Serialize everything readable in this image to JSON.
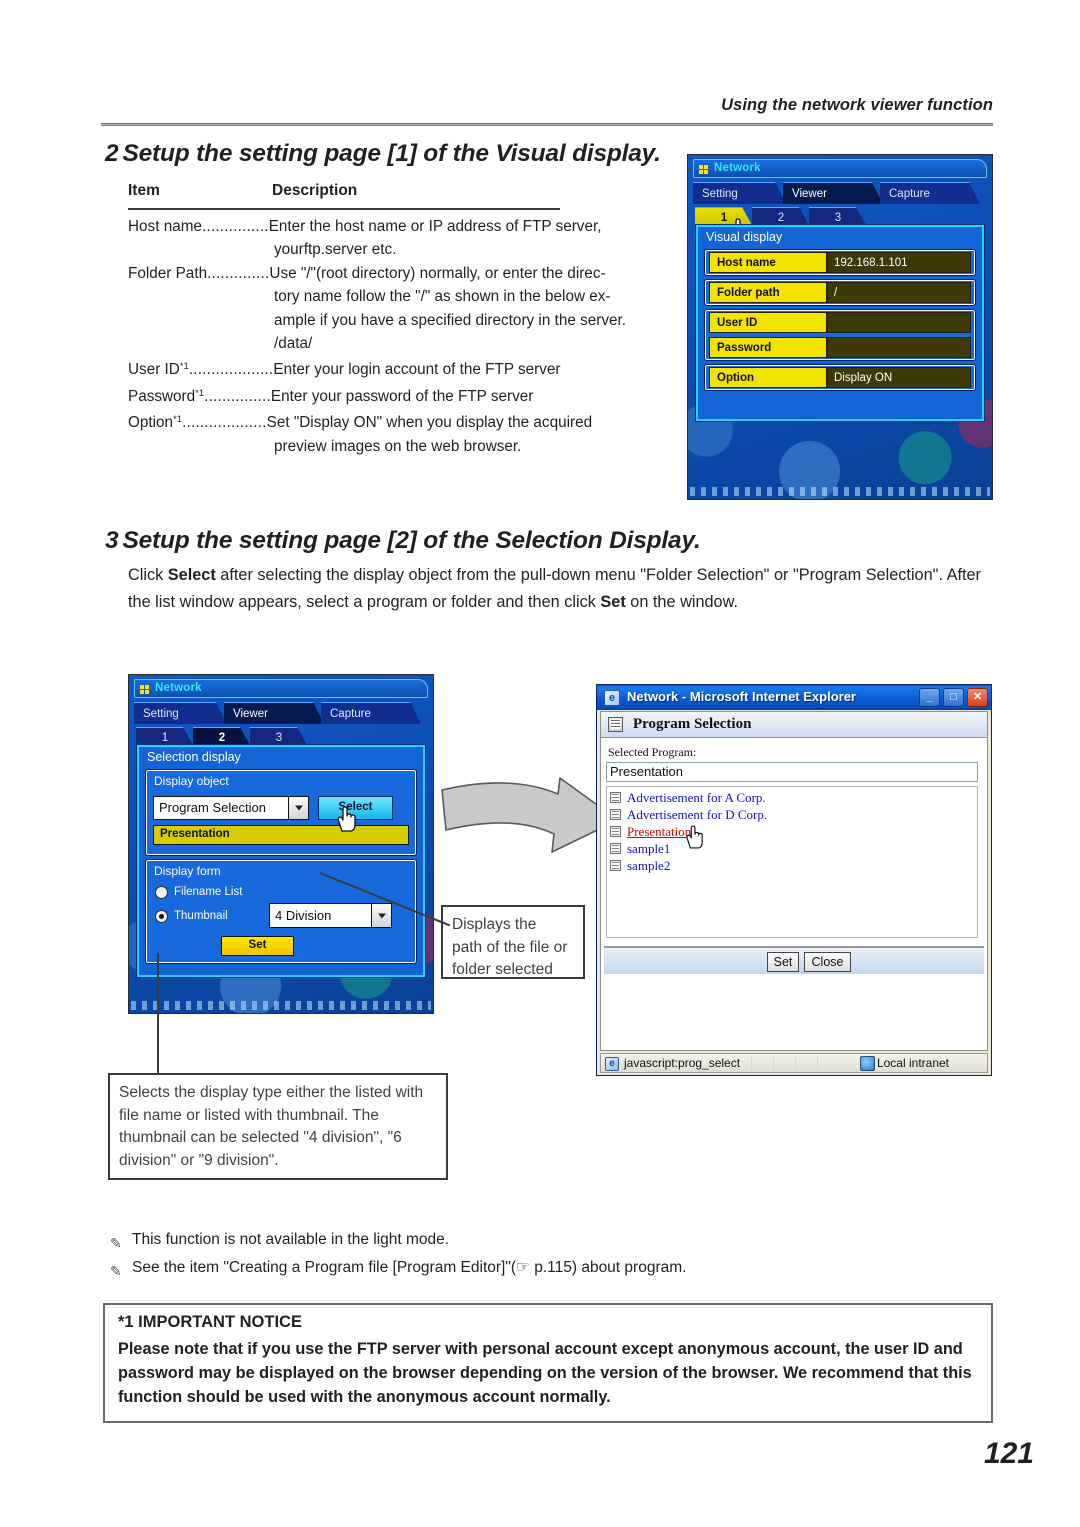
{
  "header": {
    "running_title": "Using the network viewer function"
  },
  "section2": {
    "number": "2",
    "title": "Setup the setting page [1] of the Visual display.",
    "table": {
      "col1": "Item",
      "col2": "Description",
      "rows": [
        {
          "label": "Host name",
          "dots": "...............",
          "desc": "Enter the host name or IP address of FTP server,",
          "cont": [
            "yourftp.server etc."
          ]
        },
        {
          "label": "Folder Path",
          "dots": "..............",
          "desc": "Use \"/\"(root directory) normally, or enter the direc-",
          "cont": [
            "tory name follow the \"/\" as shown in the below ex-",
            "ample if you have a specified directory in the server.",
            "/data/"
          ]
        },
        {
          "label": "User ID*1",
          "dots": "...................",
          "desc": "Enter your login account of the FTP server",
          "cont": []
        },
        {
          "label": "Password*1",
          "dots": "...............",
          "desc": "Enter your password of the FTP server",
          "cont": []
        },
        {
          "label": "Option*1",
          "dots": "...................",
          "desc": "Set \"Display ON\" when you display the acquired",
          "cont": [
            "preview images on the web browser."
          ]
        }
      ]
    }
  },
  "section3": {
    "number": "3",
    "title": "Setup the setting page [2] of the Selection Display.",
    "paragraph_parts": [
      {
        "t": "Click ",
        "b": false
      },
      {
        "t": "Select",
        "b": true
      },
      {
        "t": " after selecting the display object from the pull-down menu \"Folder Selection\" or \"Program Selection\". After the list window appears, select a program or folder and then click ",
        "b": false
      },
      {
        "t": "Set",
        "b": true
      },
      {
        "t": " on the window.",
        "b": false
      }
    ]
  },
  "osd1": {
    "title": "Network",
    "tabs": [
      {
        "label": "Setting",
        "active": false
      },
      {
        "label": "Viewer",
        "active": true
      },
      {
        "label": "Capture",
        "active": false
      }
    ],
    "subtabs": [
      {
        "label": "1",
        "state": "yellow"
      },
      {
        "label": "2",
        "state": "normal"
      },
      {
        "label": "3",
        "state": "normal"
      }
    ],
    "panel_title": "Visual display",
    "fields": [
      {
        "label": "Host name",
        "value": "192.168.1.101"
      },
      {
        "label": "Folder path",
        "value": "/"
      },
      {
        "label": "User ID",
        "value": ""
      },
      {
        "label": "Password",
        "value": ""
      },
      {
        "label": "Option",
        "value": "Display  ON"
      }
    ]
  },
  "osd2": {
    "title": "Network",
    "tabs": [
      {
        "label": "Setting",
        "active": false
      },
      {
        "label": "Viewer",
        "active": true
      },
      {
        "label": "Capture",
        "active": false
      }
    ],
    "subtabs": [
      {
        "label": "1",
        "state": "normal"
      },
      {
        "label": "2",
        "state": "dark"
      },
      {
        "label": "3",
        "state": "normal"
      }
    ],
    "panel_title": "Selection display",
    "display_object_label": "Display object",
    "display_object_value": "Program Selection",
    "select_button": "Select",
    "selected_item": "Presentation",
    "display_form_label": "Display form",
    "radio_filename": "Filename List",
    "radio_thumbnail": "Thumbnail",
    "division_value": "4 Division",
    "set_button": "Set"
  },
  "ie": {
    "window_title": "Network - Microsoft Internet Explorer",
    "minimize": "_",
    "maximize": "□",
    "close": "✕",
    "page_title": "Program Selection",
    "selected_program_label": "Selected Program:",
    "selected_program_value": "Presentation",
    "list": [
      {
        "name": "Advertisement for A Corp.",
        "selected": false
      },
      {
        "name": "Advertisement for D Corp.",
        "selected": false
      },
      {
        "name": "Presentation",
        "selected": true
      },
      {
        "name": "sample1",
        "selected": false
      },
      {
        "name": "sample2",
        "selected": false
      }
    ],
    "set_button": "Set",
    "close_button": "Close",
    "status_text": "javascript:prog_select",
    "status_zone": "Local intranet"
  },
  "callouts": {
    "path_callout": "Displays the\npath of the file or\nfolder selected",
    "display_type_callout": "Selects the display type either the listed with file name or listed with thumbnail. The thumbnail can be selected \"4 division\", \"6 division\" or \"9 division\"."
  },
  "notes": [
    "This function is not available in the light mode.",
    "See the item \"Creating a Program file [Program Editor]\"(☞ p.115)  about program."
  ],
  "notice": {
    "title": "*1 IMPORTANT NOTICE",
    "body": "Please note that if you use the FTP server with personal account except anonymous account, the user ID and password may be displayed on the browser depending on the version of the browser. We recommend that this function should be used with the anonymous account normally."
  },
  "page_number": "121",
  "colors": {
    "osd_yellow": "#f2e400",
    "osd_blue": "#1364d4",
    "osd_cyan_border": "#21d4ff",
    "ie_blue": "#0b5fd4",
    "link_blue": "#1111cc",
    "link_selected_red": "#e00000"
  }
}
